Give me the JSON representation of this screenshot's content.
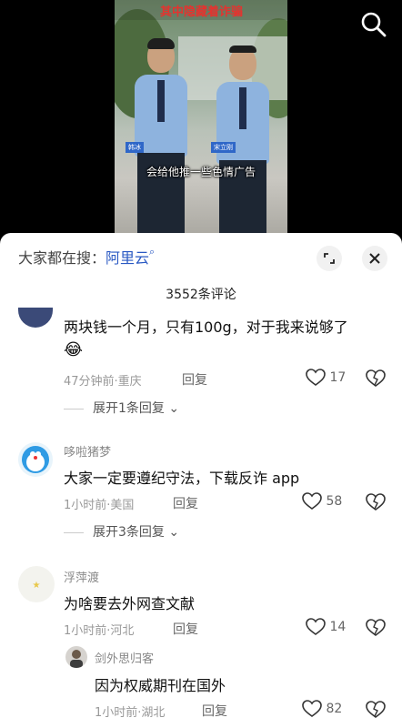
{
  "video": {
    "banner_text": "其中隐藏着诈骗",
    "subtitle": "会给他推一些色情广告",
    "name_tag_left": "韩冰",
    "name_tag_right": "宋立刚",
    "search_icon": "search-icon"
  },
  "panel": {
    "search_prefix": "大家都在搜：",
    "search_keyword": "阿里云",
    "comment_count": "3552条评论",
    "expand_icon": "expand-icon",
    "close_icon": "close-icon"
  },
  "comments": [
    {
      "text": "两块钱一个月，只有100g，对于我来说够了",
      "emoji": "😂",
      "time_location": "47分钟前·重庆",
      "reply_label": "回复",
      "likes": "17",
      "expand_label": "展开1条回复"
    },
    {
      "username": "哆啦猪梦",
      "text": "大家一定要遵纪守法，下载反诈 app",
      "time_location": "1小时前·美国",
      "reply_label": "回复",
      "likes": "58",
      "expand_label": "展开3条回复"
    },
    {
      "username": "浮萍渡",
      "text": "为啥要去外网查文献",
      "time_location": "1小时前·河北",
      "reply_label": "回复",
      "likes": "14"
    },
    {
      "username": "剑外思归客",
      "text": "因为权威期刊在国外",
      "time_location": "1小时前·湖北",
      "reply_label": "回复",
      "likes": "82"
    }
  ],
  "colors": {
    "keyword": "#2a59c3",
    "video_bg": "#000000",
    "panel_bg": "#ffffff"
  }
}
